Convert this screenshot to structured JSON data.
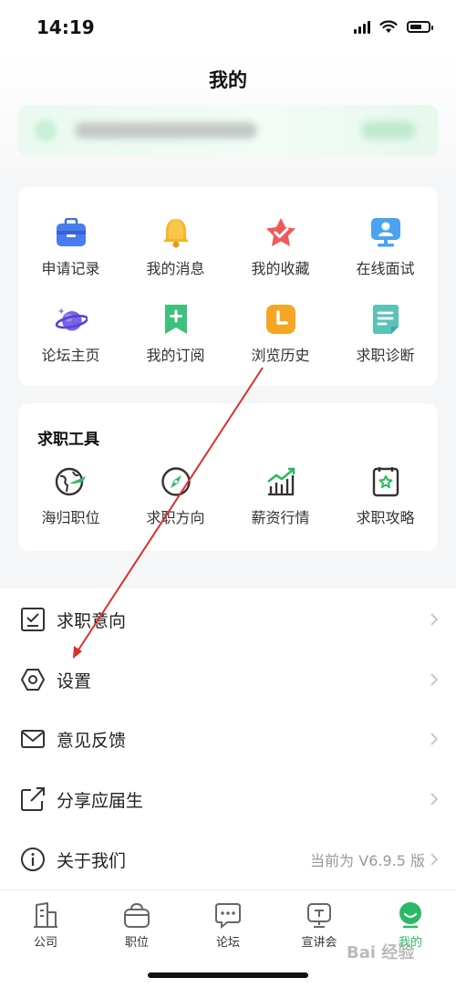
{
  "status": {
    "time": "14:19"
  },
  "header": {
    "title": "我的"
  },
  "quick_grid": [
    {
      "label": "申请记录",
      "icon": "briefcase-icon"
    },
    {
      "label": "我的消息",
      "icon": "bell-icon"
    },
    {
      "label": "我的收藏",
      "icon": "star-icon"
    },
    {
      "label": "在线面试",
      "icon": "video-interview-icon"
    },
    {
      "label": "论坛主页",
      "icon": "planet-icon"
    },
    {
      "label": "我的订阅",
      "icon": "bookmark-plus-icon"
    },
    {
      "label": "浏览历史",
      "icon": "clock-icon"
    },
    {
      "label": "求职诊断",
      "icon": "document-icon"
    }
  ],
  "tools": {
    "title": "求职工具",
    "items": [
      {
        "label": "海归职位",
        "icon": "globe-plane-icon"
      },
      {
        "label": "求职方向",
        "icon": "compass-icon"
      },
      {
        "label": "薪资行情",
        "icon": "bar-trend-icon"
      },
      {
        "label": "求职攻略",
        "icon": "guide-book-icon"
      }
    ]
  },
  "menu": [
    {
      "label": "求职意向",
      "icon": "checklist-icon",
      "value": ""
    },
    {
      "label": "设置",
      "icon": "hexagon-settings-icon",
      "value": ""
    },
    {
      "label": "意见反馈",
      "icon": "envelope-icon",
      "value": ""
    },
    {
      "label": "分享应届生",
      "icon": "share-icon",
      "value": ""
    },
    {
      "label": "关于我们",
      "icon": "info-icon",
      "value": "当前为 V6.9.5 版"
    }
  ],
  "tabbar": [
    {
      "label": "公司",
      "icon": "building-icon",
      "active": false
    },
    {
      "label": "职位",
      "icon": "bag-icon",
      "active": false
    },
    {
      "label": "论坛",
      "icon": "chat-icon",
      "active": false
    },
    {
      "label": "宣讲会",
      "icon": "presentation-icon",
      "active": false
    },
    {
      "label": "我的",
      "icon": "profile-icon",
      "active": true
    }
  ],
  "watermark": "Bai 经验",
  "colors": {
    "accent": "#2cb865",
    "annotation": "#d9302c"
  }
}
